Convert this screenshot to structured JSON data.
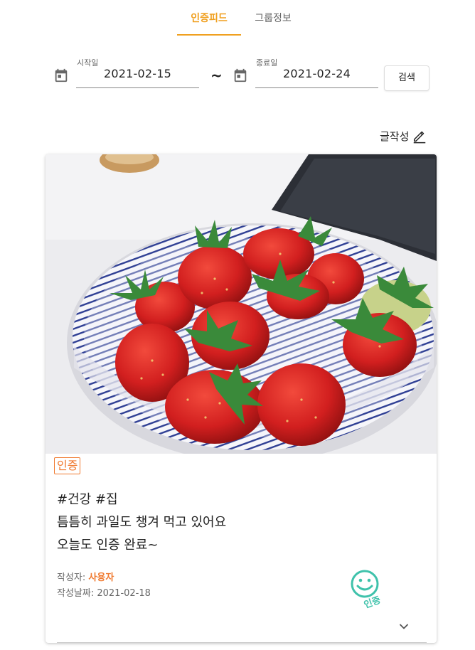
{
  "tabs": [
    {
      "label": "인증피드",
      "active": true
    },
    {
      "label": "그룹정보",
      "active": false
    }
  ],
  "filters": {
    "start_label": "시작일",
    "start_value": "2021-02-15",
    "separator": "~",
    "end_label": "종료일",
    "end_value": "2021-02-24",
    "search_label": "검색"
  },
  "write": {
    "label": "글작성",
    "icon": "pencil-icon"
  },
  "post": {
    "badge": "인증",
    "lines": [
      "#건강 #집",
      "틈틈히 과일도 챙겨 먹고 있어요",
      "오늘도 인증 완료~"
    ],
    "author_label": "작성자: ",
    "author": "사용자",
    "date_label": "작성날짜: ",
    "date": "2021-02-18",
    "stamp_text": "인증",
    "stamp_icon": "smiley-icon"
  },
  "colors": {
    "accent": "#f0a020",
    "badge": "#f07a30",
    "stamp": "#3fc2ab"
  }
}
